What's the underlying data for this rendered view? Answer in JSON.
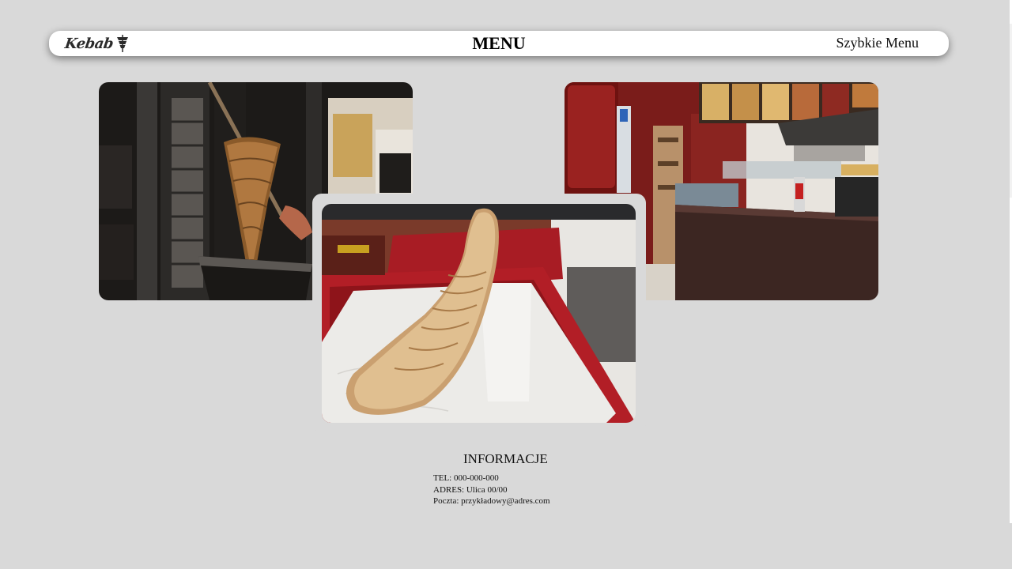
{
  "header": {
    "logo_text": "Kebab",
    "title": "MENU",
    "quick_menu_label": "Szybkie Menu"
  },
  "gallery": {
    "items": [
      {
        "name": "kebab-spit"
      },
      {
        "name": "restaurant-interior"
      },
      {
        "name": "wrap-on-tray"
      }
    ]
  },
  "info": {
    "title": "INFORMACJE",
    "phone": "TEL: 000-000-000",
    "address": "ADRES: Ulica 00/00",
    "email": "Poczta: przykładowy@adres.com"
  },
  "colors": {
    "background": "#d9d9d9",
    "navbar": "#ffffff",
    "text": "#111111"
  }
}
